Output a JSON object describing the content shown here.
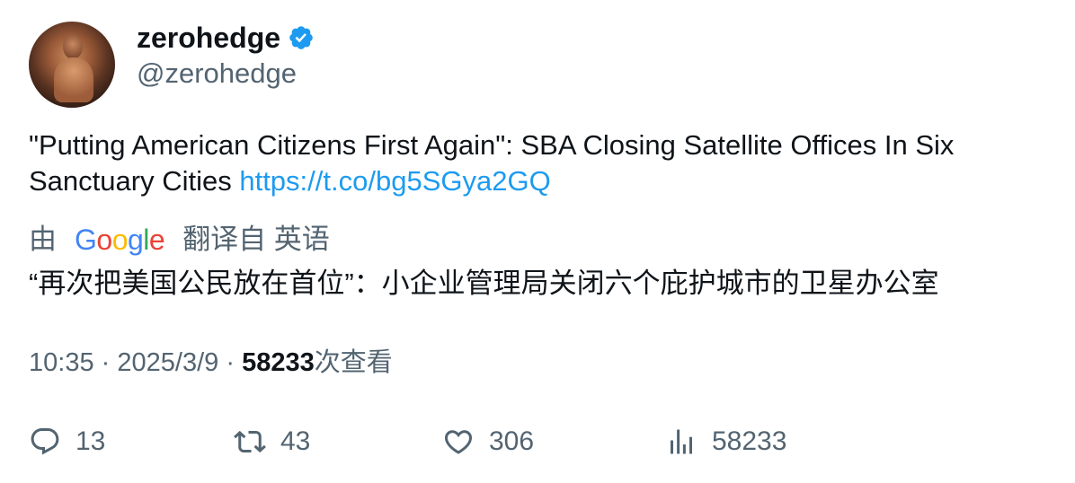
{
  "author": {
    "display_name": "zerohedge",
    "handle": "@zerohedge",
    "verified": true,
    "verified_color": "#1d9bf0"
  },
  "tweet": {
    "text": "\"Putting American Citizens First Again\": SBA Closing Satellite Offices In Six Sanctuary Cities",
    "link": "https://t.co/bg5SGya2GQ",
    "link_color": "#1d9bf0"
  },
  "translation": {
    "prefix": "由",
    "provider": "Google",
    "suffix": "翻译自 英语",
    "text": "“再次把美国公民放在首位”：小企业管理局关闭六个庇护城市的卫星办公室"
  },
  "meta": {
    "time": "10:35",
    "separator": "·",
    "date": "2025/3/9",
    "views_number": "58233",
    "views_label": "次查看"
  },
  "actions": {
    "replies": "13",
    "retweets": "43",
    "likes": "306",
    "views": "58233"
  },
  "icons": [
    "reply-icon",
    "retweet-icon",
    "like-icon",
    "views-icon",
    "verified-badge-icon"
  ]
}
